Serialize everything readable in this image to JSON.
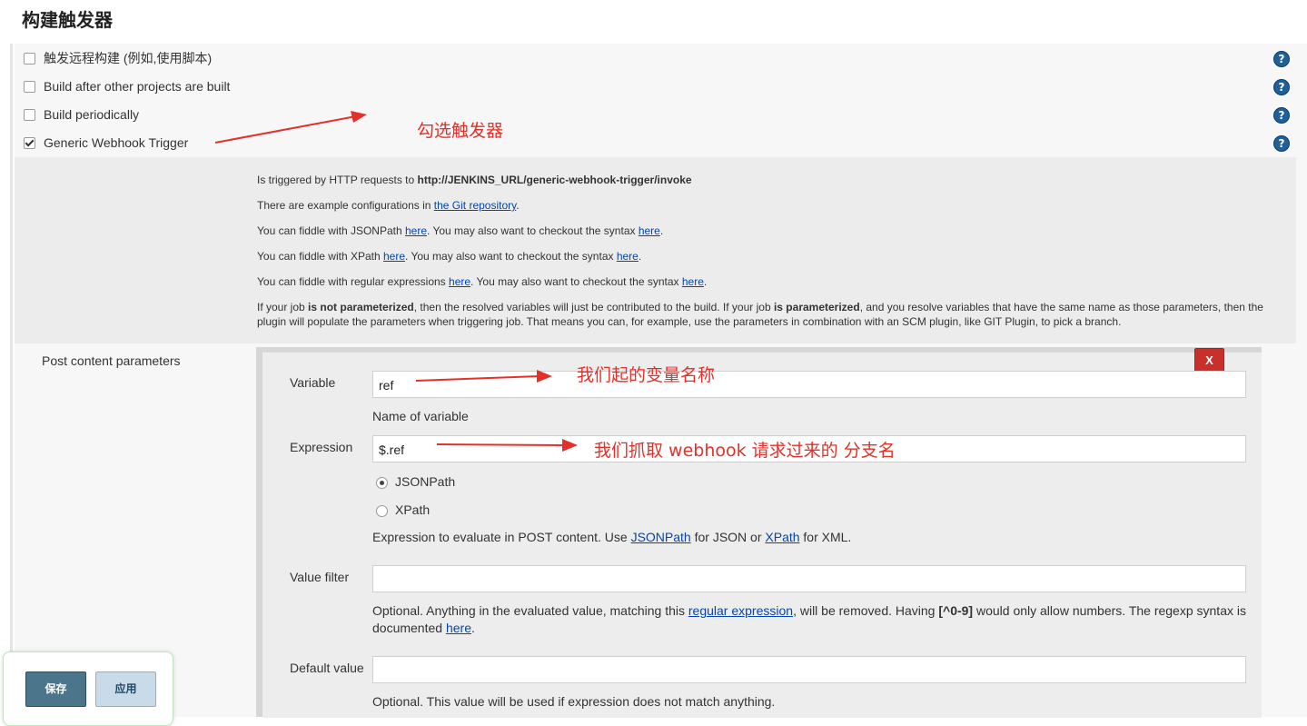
{
  "section_title": "构建触发器",
  "triggers": [
    {
      "label": "触发远程构建 (例如,使用脚本)",
      "checked": false
    },
    {
      "label": "Build after other projects are built",
      "checked": false
    },
    {
      "label": "Build periodically",
      "checked": false
    },
    {
      "label": "Generic Webhook Trigger",
      "checked": true
    }
  ],
  "help_icon": "?",
  "description": {
    "line1_prefix": "Is triggered by HTTP requests to ",
    "line1_url": "http://JENKINS_URL/generic-webhook-trigger/invoke",
    "line2_prefix": "There are example configurations in ",
    "line2_link": "the Git repository",
    "line2_suffix": ".",
    "line3_prefix": "You can fiddle with JSONPath ",
    "line3_link1": "here",
    "line3_mid": ". You may also want to checkout the syntax ",
    "line3_link2": "here",
    "line3_suffix": ".",
    "line4_prefix": "You can fiddle with XPath ",
    "line4_link1": "here",
    "line4_mid": ". You may also want to checkout the syntax ",
    "line4_link2": "here",
    "line4_suffix": ".",
    "line5_prefix": "You can fiddle with regular expressions ",
    "line5_link1": "here",
    "line5_mid": ". You may also want to checkout the syntax ",
    "line5_link2": "here",
    "line5_suffix": ".",
    "line6_a": "If your job ",
    "line6_b": "is not parameterized",
    "line6_c": ", then the resolved variables will just be contributed to the build. If your job ",
    "line6_d": "is parameterized",
    "line6_e": ", and you resolve variables that have the same name as those parameters, then the plugin will populate the parameters when triggering job. That means you can, for example, use the parameters in combination with an SCM plugin, like GIT Plugin, to pick a branch."
  },
  "post_content": {
    "label": "Post content parameters",
    "delete_label": "X",
    "variable": {
      "label": "Variable",
      "value": "ref",
      "help": "Name of variable"
    },
    "expression": {
      "label": "Expression",
      "value": "$.ref",
      "options": [
        "JSONPath",
        "XPath"
      ],
      "selected": "JSONPath",
      "help_prefix": "Expression to evaluate in POST content. Use ",
      "help_link1": "JSONPath",
      "help_mid": " for JSON or ",
      "help_link2": "XPath",
      "help_suffix": " for XML."
    },
    "value_filter": {
      "label": "Value filter",
      "value": "",
      "help_a": "Optional. Anything in the evaluated value, matching this ",
      "help_link": "regular expression",
      "help_b": ", will be removed. Having ",
      "help_bold": "[^0-9]",
      "help_c": " would only allow numbers. The regexp syntax is documented ",
      "help_link2": "here",
      "help_d": "."
    },
    "default_value": {
      "label": "Default value",
      "value": "",
      "help": "Optional. This value will be used if expression does not match anything."
    }
  },
  "annotations": {
    "trigger": "勾选触发器",
    "variable": "我们起的变量名称",
    "expression": "我们抓取 webhook 请求过来的 分支名"
  },
  "buttons": {
    "save": "保存",
    "apply": "应用"
  },
  "colors": {
    "annotation": "#e3312a",
    "link": "#0645ad",
    "save_button": "#4b758b",
    "delete_button": "#c9302c"
  }
}
